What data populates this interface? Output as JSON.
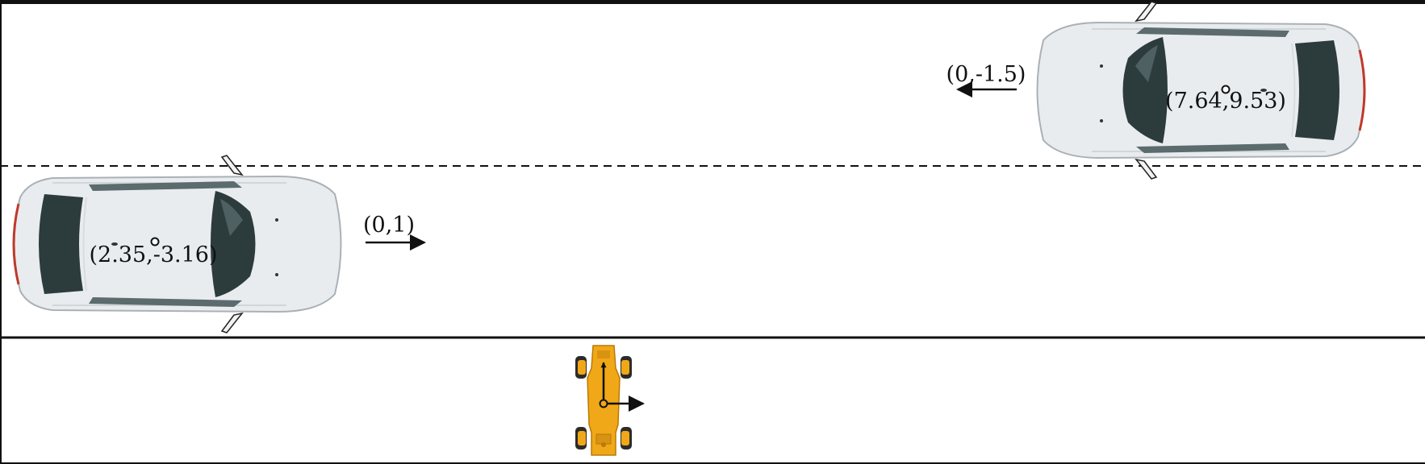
{
  "scene": {
    "colors": {
      "road_line": "#111111",
      "car_body": "#e9ecef",
      "car_glass": "#2c3c3d",
      "car_trim": "#8c9498",
      "tail_light": "#c0392b",
      "robot_body": "#f0a818",
      "robot_dark": "#2b2b2b"
    },
    "vehicles": [
      {
        "id": "car-1",
        "position_label": "(2.35,-3.16)",
        "velocity_label": "(0,1)",
        "heading": "right"
      },
      {
        "id": "car-2",
        "position_label": "(7.64,9.53)",
        "velocity_label": "(0,-1.5)",
        "heading": "left"
      }
    ],
    "robot": {
      "icon": "legged-robot-icon",
      "axes": [
        "forward-axis-arrow",
        "lateral-axis-arrow"
      ]
    }
  }
}
